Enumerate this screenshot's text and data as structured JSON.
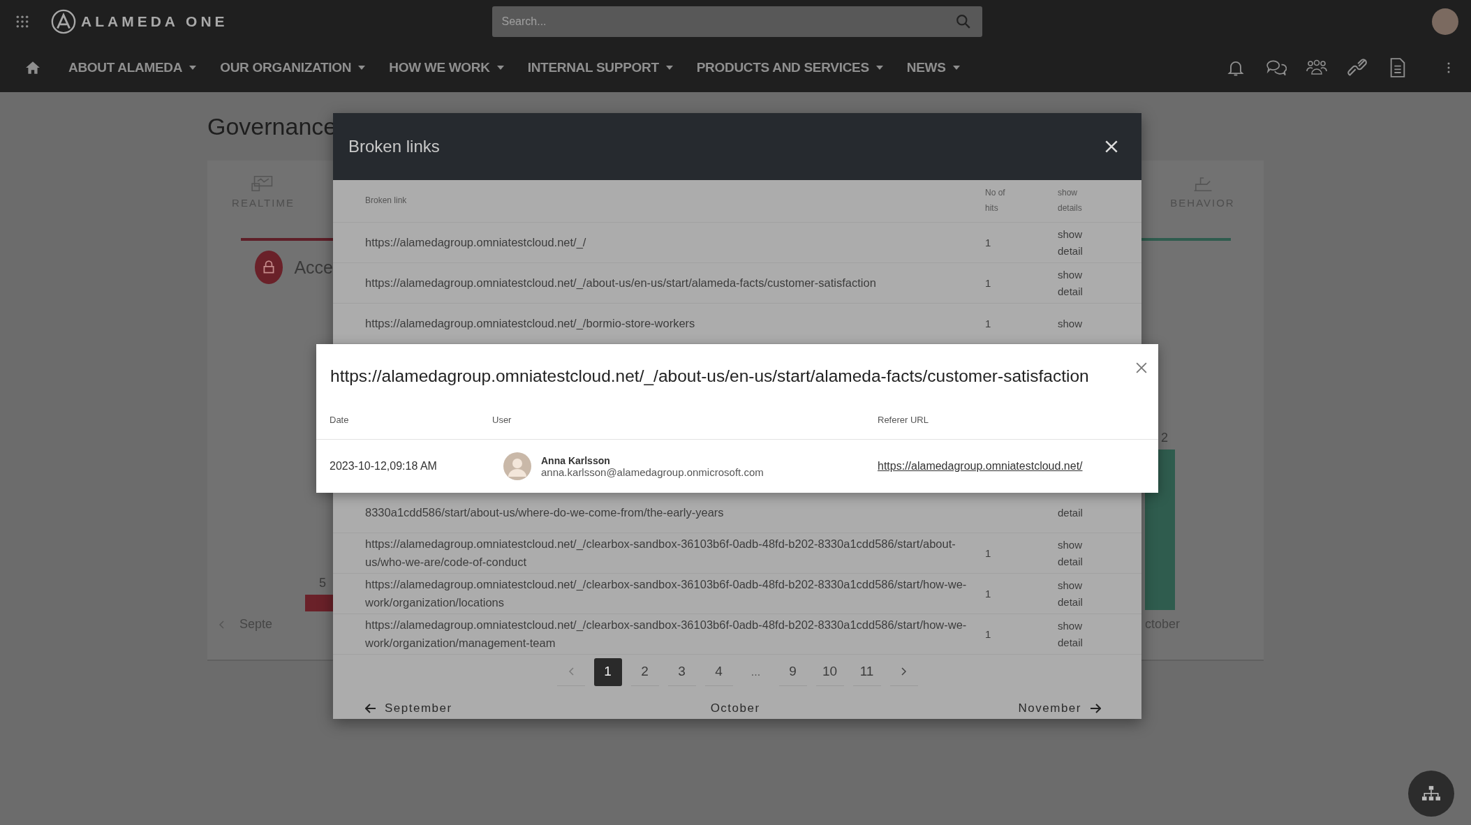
{
  "top_bar": {
    "logo_text": "ALAMEDA ONE",
    "search": {
      "placeholder": "Search..."
    }
  },
  "nav": {
    "items": [
      {
        "label": "ABOUT ALAMEDA"
      },
      {
        "label": "OUR ORGANIZATION"
      },
      {
        "label": "HOW WE WORK"
      },
      {
        "label": "INTERNAL SUPPORT"
      },
      {
        "label": "PRODUCTS AND SERVICES"
      },
      {
        "label": "NEWS"
      }
    ]
  },
  "page": {
    "title": "Governance",
    "left_panel": {
      "tab": "REALTIME",
      "card_title": "Acce",
      "bar_value": "5",
      "month": "Septe"
    },
    "right_panel": {
      "tab": "BEHAVIOR",
      "bar_value": "2",
      "month": "ctober"
    }
  },
  "modal": {
    "title": "Broken links",
    "columns": [
      "Broken link",
      "No of hits",
      "show details"
    ],
    "rows": [
      {
        "link": "https://alamedagroup.omniatestcloud.net/_/",
        "hits": "1",
        "action": "show detail"
      },
      {
        "link": "https://alamedagroup.omniatestcloud.net/_/about-us/en-us/start/alameda-facts/customer-satisfaction",
        "hits": "1",
        "action": "show detail"
      },
      {
        "link": "https://alamedagroup.omniatestcloud.net/_/bormio-store-workers",
        "hits": "1",
        "action": "show"
      }
    ],
    "rows_below": [
      {
        "link": "8330a1cdd586/start/about-us/where-do-we-come-from/the-early-years",
        "action": "detail"
      },
      {
        "link": "https://alamedagroup.omniatestcloud.net/_/clearbox-sandbox-36103b6f-0adb-48fd-b202-8330a1cdd586/start/about-us/who-we-are/code-of-conduct",
        "hits": "1",
        "action": "show detail"
      },
      {
        "link": "https://alamedagroup.omniatestcloud.net/_/clearbox-sandbox-36103b6f-0adb-48fd-b202-8330a1cdd586/start/how-we-work/organization/locations",
        "hits": "1",
        "action": "show detail"
      },
      {
        "link": "https://alamedagroup.omniatestcloud.net/_/clearbox-sandbox-36103b6f-0adb-48fd-b202-8330a1cdd586/start/how-we-work/organization/management-team",
        "hits": "1",
        "action": "show detail"
      }
    ],
    "pagination": [
      {
        "kind": "page",
        "label": "1",
        "selected": true
      },
      {
        "kind": "page",
        "label": "2",
        "selected": false
      },
      {
        "kind": "page",
        "label": "3",
        "selected": false
      },
      {
        "kind": "page",
        "label": "4",
        "selected": false
      },
      {
        "kind": "ellipsis",
        "label": "..."
      },
      {
        "kind": "page",
        "label": "9",
        "selected": false
      },
      {
        "kind": "page",
        "label": "10",
        "selected": false
      },
      {
        "kind": "page",
        "label": "11",
        "selected": false
      }
    ],
    "month_nav": {
      "previous": "September",
      "current": "October",
      "next": "November"
    }
  },
  "detail_popup": {
    "title": "https://alamedagroup.omniatestcloud.net/_/about-us/en-us/start/alameda-facts/customer-satisfaction",
    "columns": [
      "Date",
      "User",
      "Referer URL"
    ],
    "rows": [
      {
        "date": "2023-10-12,09:18 AM",
        "user_name": "Anna Karlsson",
        "user_email": "anna.karlsson@alamedagroup.onmicrosoft.com",
        "referer_url": "https://alamedagroup.omniatestcloud.net/"
      }
    ]
  }
}
